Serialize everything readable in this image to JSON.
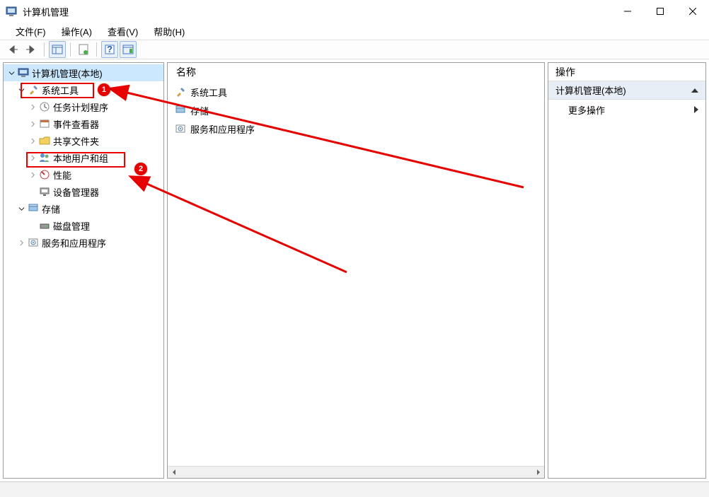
{
  "window": {
    "title": "计算机管理"
  },
  "menu": {
    "file": "文件(F)",
    "action": "操作(A)",
    "view": "查看(V)",
    "help": "帮助(H)"
  },
  "tree": {
    "root": "计算机管理(本地)",
    "system_tools": "系统工具",
    "task_scheduler": "任务计划程序",
    "event_viewer": "事件查看器",
    "shared_folders": "共享文件夹",
    "local_users_groups": "本地用户和组",
    "performance": "性能",
    "device_manager": "设备管理器",
    "storage": "存储",
    "disk_management": "磁盘管理",
    "services_apps": "服务和应用程序"
  },
  "content": {
    "header_name": "名称",
    "items": {
      "system_tools": "系统工具",
      "storage": "存储",
      "services_apps": "服务和应用程序"
    }
  },
  "actions": {
    "header": "操作",
    "group_title": "计算机管理(本地)",
    "more_actions": "更多操作"
  },
  "annotations": {
    "badge1": "1",
    "badge2": "2"
  }
}
